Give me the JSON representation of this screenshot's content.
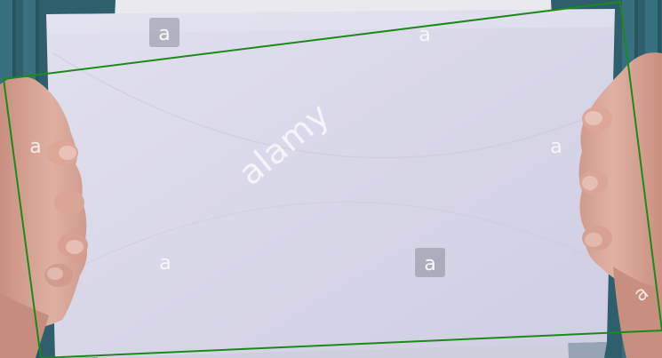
{
  "image": {
    "subject": "hands holding a blank sheet of paper",
    "colors": {
      "background_wall": "#2f5f6c",
      "background_slats": "#3b7483",
      "paper": "#d9d8e8",
      "paper_shadow": "#c9c8da",
      "skin": "#d9a99a",
      "skin_shadow": "#b87f72",
      "shirt": "#e9e9ee",
      "detection_box": "#1a8a1a"
    }
  },
  "watermark": {
    "brand": "alamy",
    "badge_letter": "a"
  }
}
